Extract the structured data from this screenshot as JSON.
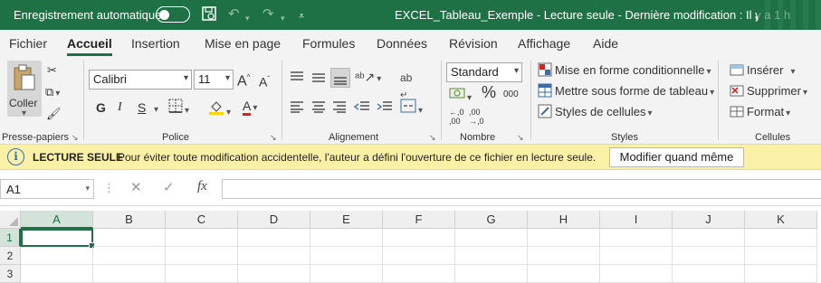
{
  "titlebar": {
    "autosave_label": "Enregistrement automatique",
    "document_title": "EXCEL_Tableau_Exemple  -  Lecture seule  -  Dernière modification : Il y a 1 h",
    "accent": "#1e7145"
  },
  "tabs": [
    "Fichier",
    "Accueil",
    "Insertion",
    "Mise en page",
    "Formules",
    "Données",
    "Révision",
    "Affichage",
    "Aide"
  ],
  "active_tab": "Accueil",
  "ribbon": {
    "clipboard": {
      "paste_label": "Coller",
      "group_label": "Presse-papiers"
    },
    "font": {
      "font_name": "Calibri",
      "font_size": "11",
      "grow_label": "A",
      "shrink_label": "A",
      "bold": "G",
      "italic": "I",
      "underline": "S",
      "color_glyph": "A",
      "group_label": "Police"
    },
    "alignment": {
      "group_label": "Alignement",
      "wrap_glyph": "ab"
    },
    "number": {
      "format": "Standard",
      "percent": "%",
      "thousands": "000",
      "inc_decimal": "←,0 ,00",
      "dec_decimal": ",00 →,0",
      "group_label": "Nombre"
    },
    "styles": {
      "conditional": "Mise en forme conditionnelle",
      "table": "Mettre sous forme de tableau",
      "cell_styles": "Styles de cellules",
      "group_label": "Styles"
    },
    "cells": {
      "insert": "Insérer",
      "delete": "Supprimer",
      "format": "Format",
      "group_label": "Cellules"
    }
  },
  "infobar": {
    "icon": "i",
    "title": "LECTURE SEULE",
    "message": "Pour éviter toute modification accidentelle, l'auteur a défini l'ouverture de ce fichier en lecture seule.",
    "button": "Modifier quand même",
    "background": "#fbf1a6"
  },
  "formula_bar": {
    "name_box": "A1",
    "fx": "fx",
    "value": ""
  },
  "grid": {
    "columns": [
      "A",
      "B",
      "C",
      "D",
      "E",
      "F",
      "G",
      "H",
      "I",
      "J",
      "K"
    ],
    "rows": [
      "1",
      "2",
      "3"
    ],
    "selected_cell": "A1"
  }
}
